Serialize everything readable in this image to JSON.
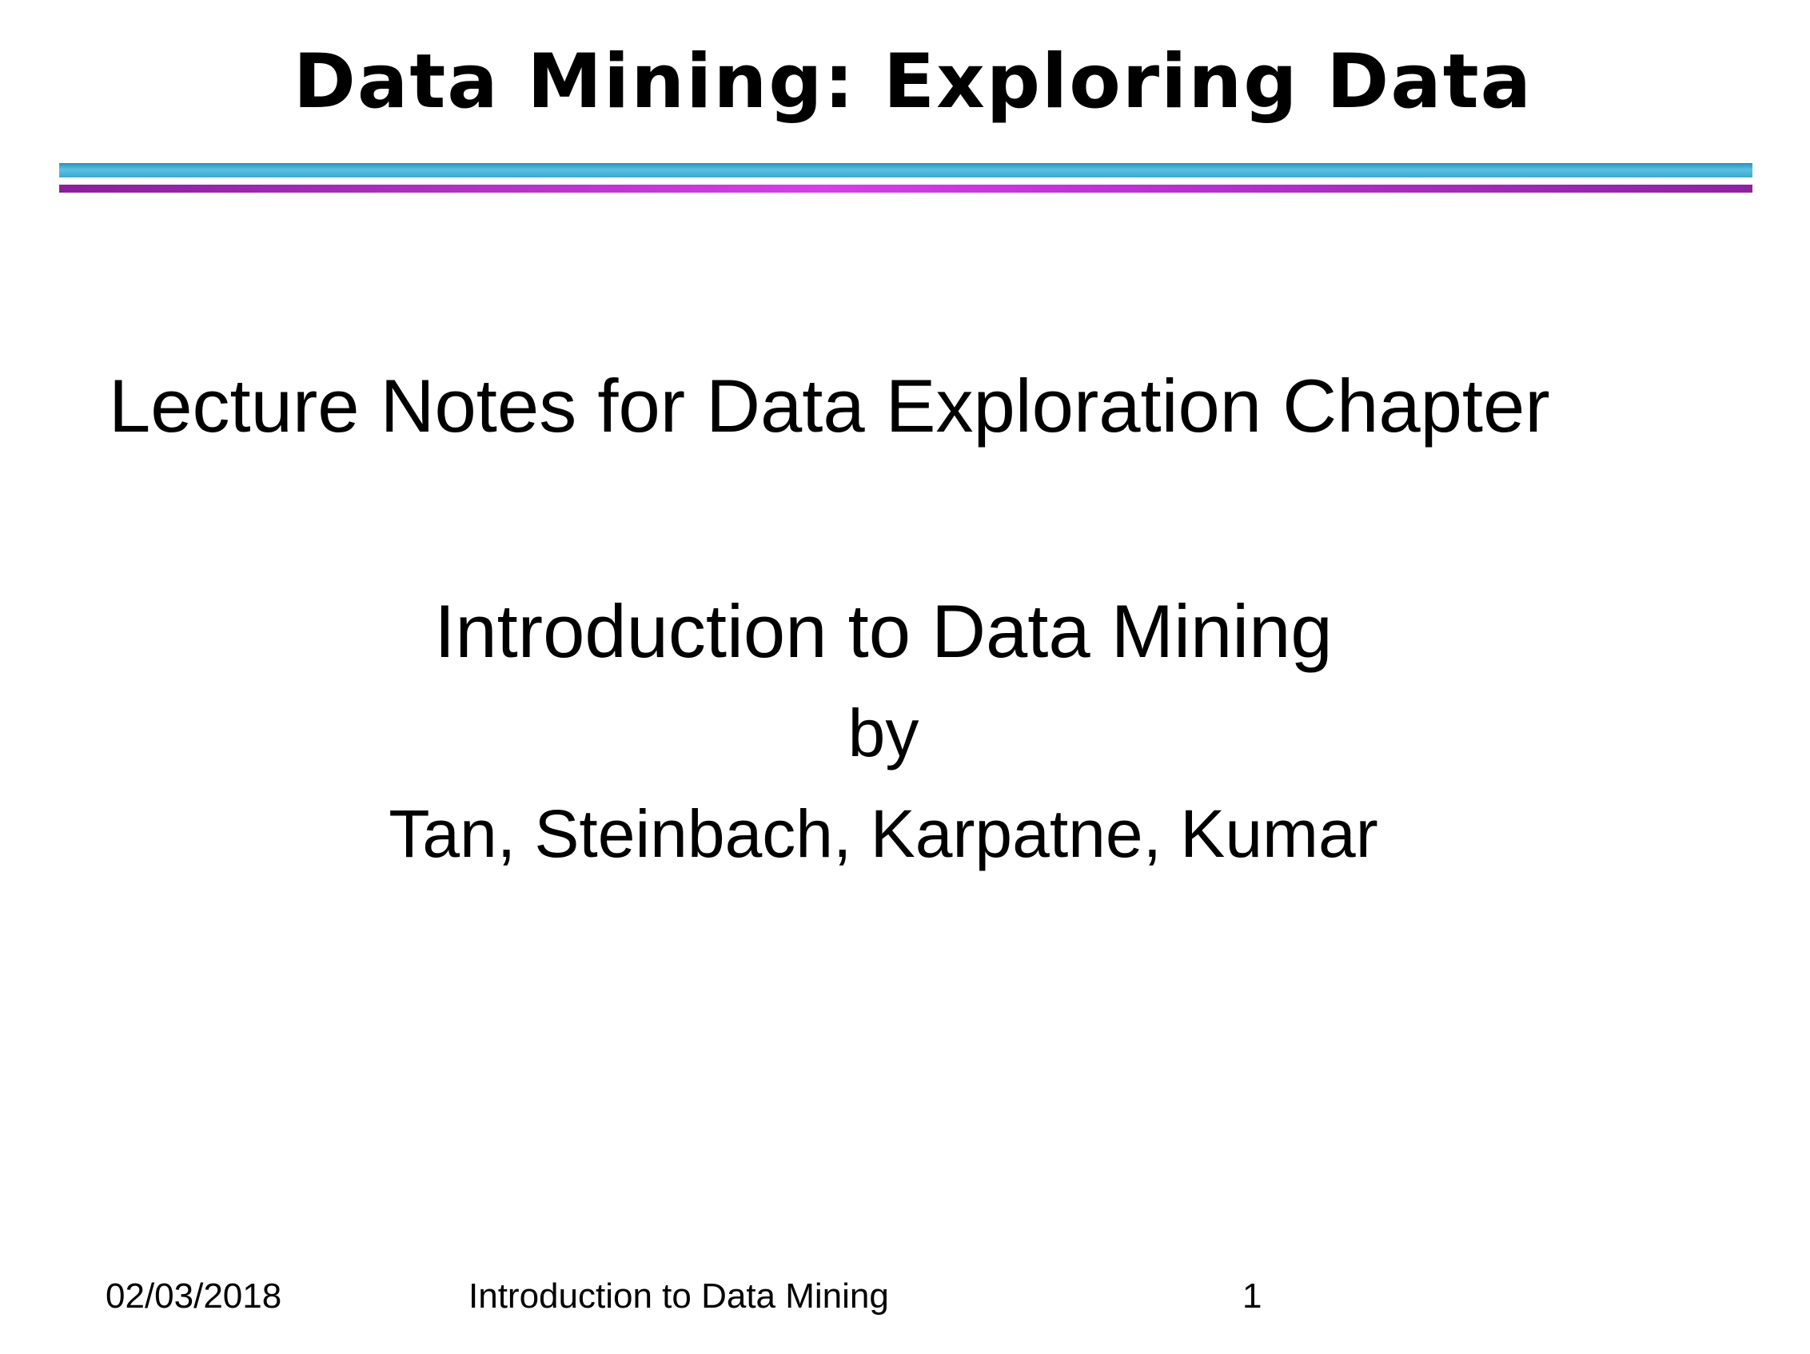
{
  "slide": {
    "title": "Data Mining: Exploring Data",
    "lecture_notes": "Lecture Notes for Data Exploration Chapter",
    "book_title": "Introduction to Data Mining",
    "by": "by",
    "authors": "Tan, Steinbach, Karpatne, Kumar"
  },
  "footer": {
    "date": "02/03/2018",
    "title": "Introduction to Data Mining",
    "page_number": "1"
  },
  "colors": {
    "rule_top": "#4fb6dc",
    "rule_bottom": "#c83ddc",
    "text": "#000000",
    "background": "#ffffff"
  }
}
